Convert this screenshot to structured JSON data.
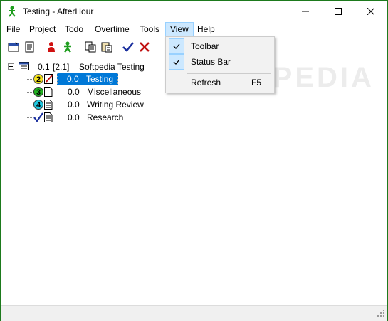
{
  "window": {
    "title": "Testing - AfterHour"
  },
  "menubar": {
    "items": [
      "File",
      "Project",
      "Todo",
      "Overtime",
      "Tools",
      "View",
      "Help"
    ]
  },
  "view_menu": {
    "items": [
      {
        "label": "Toolbar",
        "checked": true,
        "shortcut": ""
      },
      {
        "label": "Status Bar",
        "checked": true,
        "shortcut": ""
      },
      {
        "label": "Refresh",
        "checked": false,
        "shortcut": "F5"
      }
    ]
  },
  "toolbar": {
    "icons": [
      "new-project-icon",
      "properties-icon",
      "red-person-icon",
      "green-person-icon",
      "copy-icon",
      "paste-icon",
      "check-icon",
      "cross-icon"
    ]
  },
  "tree": {
    "root": {
      "hours": "0.1",
      "total": "[2.1]",
      "name": "Softpedia Testing"
    },
    "children": [
      {
        "badge": "2",
        "hours": "0.0",
        "name": "Testing"
      },
      {
        "badge": "3",
        "hours": "0.0",
        "name": "Miscellaneous"
      },
      {
        "badge": "4",
        "hours": "0.0",
        "name": "Writing Review"
      },
      {
        "badge": "",
        "hours": "0.0",
        "name": "Research"
      }
    ]
  },
  "watermark": "SOFTPEDIA"
}
